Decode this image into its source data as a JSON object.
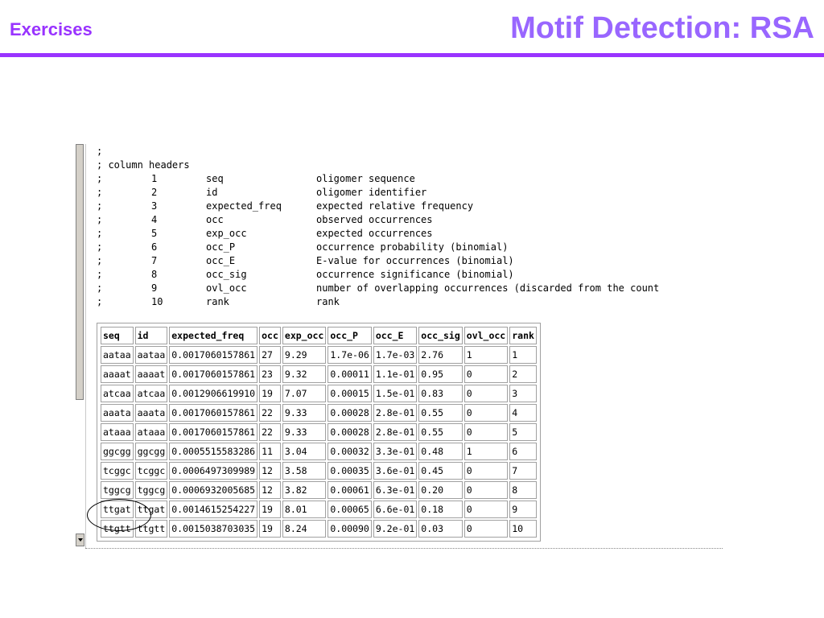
{
  "header": {
    "section_label": "Exercises",
    "title": "Motif Detection: RSA",
    "accent_color": "#9933ff"
  },
  "output": {
    "comment_lines": [
      ";",
      "; column headers"
    ],
    "column_headers": [
      {
        "prefix": ";",
        "num": "1",
        "name": "seq",
        "desc": "oligomer sequence"
      },
      {
        "prefix": ";",
        "num": "2",
        "name": "id",
        "desc": "oligomer identifier"
      },
      {
        "prefix": ";",
        "num": "3",
        "name": "expected_freq",
        "desc": "expected relative frequency"
      },
      {
        "prefix": ";",
        "num": "4",
        "name": "occ",
        "desc": "observed occurrences"
      },
      {
        "prefix": ";",
        "num": "5",
        "name": "exp_occ",
        "desc": "expected occurrences"
      },
      {
        "prefix": ";",
        "num": "6",
        "name": "occ_P",
        "desc": "occurrence probability (binomial)"
      },
      {
        "prefix": ";",
        "num": "7",
        "name": "occ_E",
        "desc": "E-value for occurrences (binomial)"
      },
      {
        "prefix": ";",
        "num": "8",
        "name": "occ_sig",
        "desc": "occurrence significance (binomial)"
      },
      {
        "prefix": ";",
        "num": "9",
        "name": "ovl_occ",
        "desc": "number of overlapping occurrences (discarded from the count"
      },
      {
        "prefix": ";",
        "num": "10",
        "name": "rank",
        "desc": "rank"
      }
    ]
  },
  "table": {
    "headers": [
      "seq",
      "id",
      "expected_freq",
      "occ",
      "exp_occ",
      "occ_P",
      "occ_E",
      "occ_sig",
      "ovl_occ",
      "rank"
    ],
    "rows": [
      [
        "aataa",
        "aataa",
        "0.0017060157861",
        "27",
        "9.29",
        "1.7e-06",
        "1.7e-03",
        "2.76",
        "1",
        "1"
      ],
      [
        "aaaat",
        "aaaat",
        "0.0017060157861",
        "23",
        "9.32",
        "0.00011",
        "1.1e-01",
        "0.95",
        "0",
        "2"
      ],
      [
        "atcaa",
        "atcaa",
        "0.0012906619910",
        "19",
        "7.07",
        "0.00015",
        "1.5e-01",
        "0.83",
        "0",
        "3"
      ],
      [
        "aaata",
        "aaata",
        "0.0017060157861",
        "22",
        "9.33",
        "0.00028",
        "2.8e-01",
        "0.55",
        "0",
        "4"
      ],
      [
        "ataaa",
        "ataaa",
        "0.0017060157861",
        "22",
        "9.33",
        "0.00028",
        "2.8e-01",
        "0.55",
        "0",
        "5"
      ],
      [
        "ggcgg",
        "ggcgg",
        "0.0005515583286",
        "11",
        "3.04",
        "0.00032",
        "3.3e-01",
        "0.48",
        "1",
        "6"
      ],
      [
        "tcggc",
        "tcggc",
        "0.0006497309989",
        "12",
        "3.58",
        "0.00035",
        "3.6e-01",
        "0.45",
        "0",
        "7"
      ],
      [
        "tggcg",
        "tggcg",
        "0.0006932005685",
        "12",
        "3.82",
        "0.00061",
        "6.3e-01",
        "0.20",
        "0",
        "8"
      ],
      [
        "ttgat",
        "ttgat",
        "0.0014615254227",
        "19",
        "8.01",
        "0.00065",
        "6.6e-01",
        "0.18",
        "0",
        "9"
      ],
      [
        "ttgtt",
        "ttgtt",
        "0.0015038703035",
        "19",
        "8.24",
        "0.00090",
        "9.2e-01",
        "0.03",
        "0",
        "10"
      ]
    ],
    "highlighted_row_index": 8
  }
}
